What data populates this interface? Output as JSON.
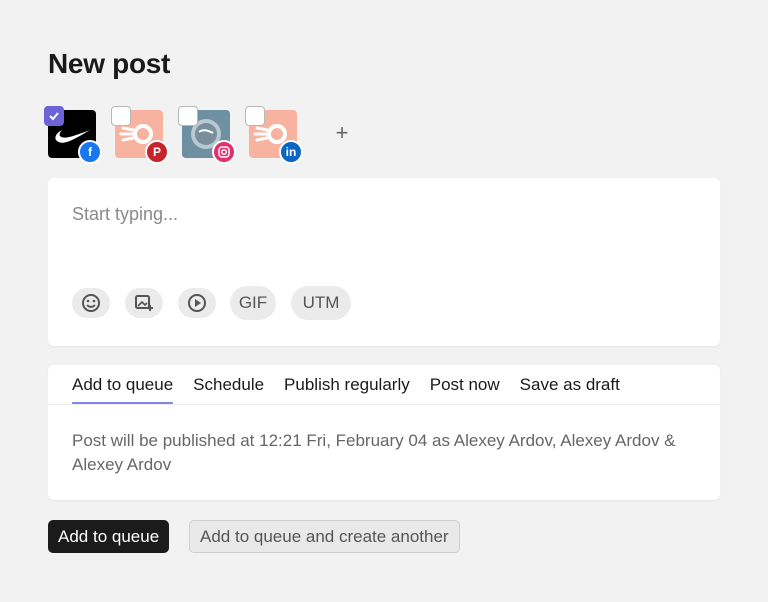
{
  "page": {
    "title": "New post"
  },
  "accounts": [
    {
      "avatar": "nike-logo",
      "network": "facebook",
      "network_color": "#1877f2",
      "checked": true
    },
    {
      "avatar": "hubspot-logo",
      "network": "pinterest",
      "network_color": "#c8232c",
      "checked": false
    },
    {
      "avatar": "virgin-logo",
      "network": "instagram",
      "network_color": "#e1306c",
      "checked": false
    },
    {
      "avatar": "hubspot-logo",
      "network": "linkedin",
      "network_color": "#0a66c2",
      "checked": false
    }
  ],
  "add_account_label": "+",
  "composer": {
    "placeholder": "Start typing...",
    "value": "",
    "tools": [
      {
        "icon": "emoji-icon"
      },
      {
        "icon": "image-icon"
      },
      {
        "icon": "video-icon"
      },
      {
        "label": "GIF"
      },
      {
        "label": "UTM"
      }
    ]
  },
  "publish": {
    "tabs": [
      "Add to queue",
      "Schedule",
      "Publish regularly",
      "Post now",
      "Save as draft"
    ],
    "active_tab": "Add to queue",
    "message": "Post will be published at 12:21 Fri, February 04 as  Alexey Ardov,   Alexey Ardov &  Alexey Ardov"
  },
  "buttons": {
    "primary": "Add to queue",
    "secondary": "Add to queue and create another"
  },
  "colors": {
    "accent": "#6c63d9",
    "tab_underline": "#7f86e8",
    "hubspot_orange": "#f7b3a0"
  }
}
